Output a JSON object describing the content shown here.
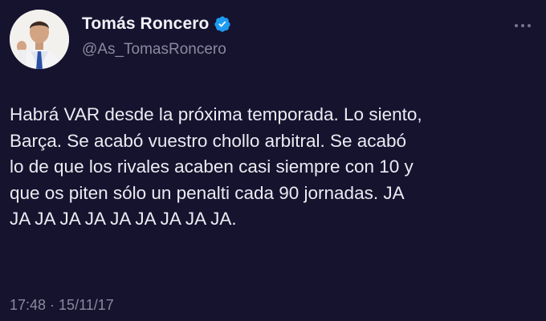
{
  "author": {
    "display_name": "Tomás Roncero",
    "handle": "@As_TomasRoncero",
    "verified": true,
    "avatar_icon": "profile-photo"
  },
  "tweet": {
    "text": "Habrá VAR desde la próxima temporada. Lo siento,\nBarça. Se acabó vuestro chollo arbitral. Se acabó\nlo de que los rivales acaben casi siempre con 10 y\nque os piten sólo un penalti cada 90 jornadas. JA\nJA JA JA JA JA JA JA JA JA.",
    "time": "17:48",
    "separator": " · ",
    "date": "15/11/17"
  },
  "colors": {
    "background": "#16132f",
    "text": "#ecebf2",
    "secondary_text": "#8b889f",
    "verified_badge": "#1d9bf0"
  },
  "icons": {
    "verified": "verified-badge-icon",
    "more": "more-options-icon"
  }
}
